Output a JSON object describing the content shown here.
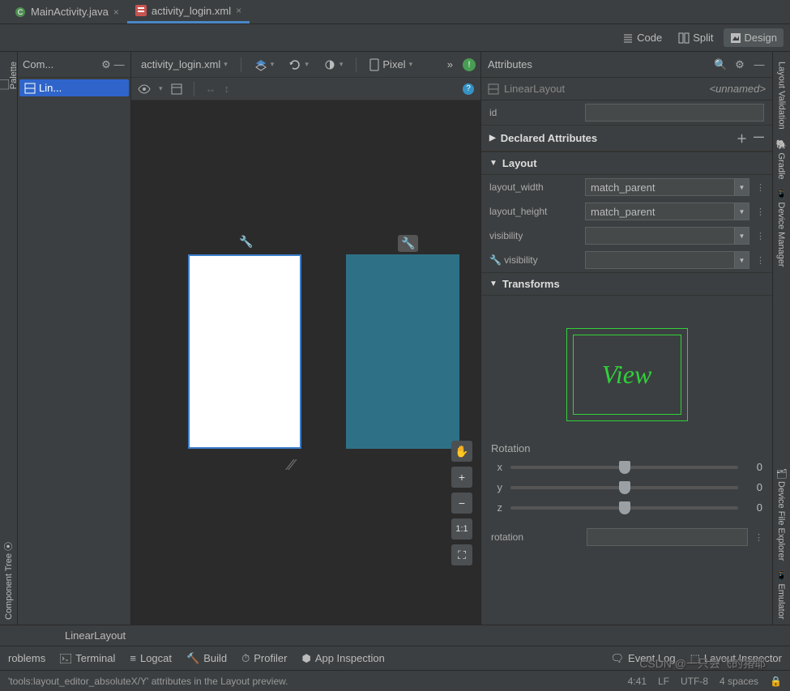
{
  "tabs": [
    {
      "label": "MainActivity.java",
      "active": false
    },
    {
      "label": "activity_login.xml",
      "active": true
    }
  ],
  "viewModes": {
    "code": "Code",
    "split": "Split",
    "design": "Design"
  },
  "rails": {
    "left": [
      "Palette",
      "Component Tree"
    ],
    "right": [
      "Layout Validation",
      "Gradle",
      "Device Manager",
      "Device File Explorer",
      "Emulator"
    ]
  },
  "componentPanel": {
    "title": "Com...",
    "selected": "Lin..."
  },
  "canvasToolbar": {
    "file": "activity_login.xml",
    "device": "Pixel",
    "moreSymbol": "»"
  },
  "zoom": {
    "hand": "✋",
    "plus": "+",
    "minus": "−",
    "oneToOne": "1:1",
    "fit": "⛶"
  },
  "attributes": {
    "title": "Attributes",
    "component": "LinearLayout",
    "unnamed": "<unnamed>",
    "id": {
      "label": "id",
      "value": ""
    },
    "sections": {
      "declared": "Declared Attributes",
      "layout": "Layout",
      "transforms": "Transforms"
    },
    "layout_width": {
      "label": "layout_width",
      "value": "match_parent"
    },
    "layout_height": {
      "label": "layout_height",
      "value": "match_parent"
    },
    "visibility": {
      "label": "visibility",
      "value": ""
    },
    "visibility2": {
      "label": "visibility",
      "value": ""
    },
    "viewText": "View",
    "rotation": {
      "title": "Rotation",
      "x": {
        "label": "x",
        "value": "0"
      },
      "y": {
        "label": "y",
        "value": "0"
      },
      "z": {
        "label": "z",
        "value": "0"
      },
      "rotLabel": "rotation"
    }
  },
  "breadcrumb": "LinearLayout",
  "bottomBar": {
    "problems": "roblems",
    "terminal": "Terminal",
    "logcat": "Logcat",
    "build": "Build",
    "profiler": "Profiler",
    "appInspection": "App Inspection",
    "eventLog": "Event Log",
    "layoutInspector": "Layout Inspector"
  },
  "statusBar": {
    "message": "'tools:layout_editor_absoluteX/Y' attributes in the Layout preview.",
    "pos": "4:41",
    "lineEnding": "LF",
    "encoding": "UTF-8",
    "indent": "4 spaces"
  },
  "watermark": "CSDN @一只会飞的猪耶"
}
